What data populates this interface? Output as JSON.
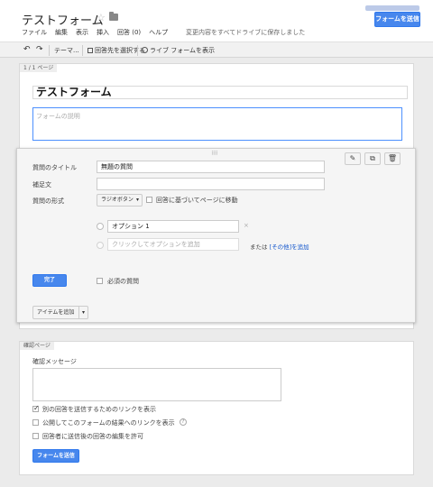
{
  "header": {
    "title": "テストフォーム",
    "menu": [
      "ファイル",
      "編集",
      "表示",
      "挿入",
      "回答 (0)",
      "ヘルプ"
    ],
    "save_status": "変更内容をすべてドライブに保存しました",
    "send_button": "フォームを送信"
  },
  "toolbar": {
    "theme": "テーマ...",
    "choose_dest": "回答先を選択する",
    "live_form": "ライブ フォームを表示"
  },
  "page1": {
    "label": "1 / 1 ページ",
    "form_title": "テストフォーム",
    "description_placeholder": "フォームの説明"
  },
  "question": {
    "title_label": "質問のタイトル",
    "title_value": "無題の質問",
    "help_label": "補足文",
    "help_value": "",
    "type_label": "質問の形式",
    "type_value": "ラジオボタン",
    "goto_page_label": "回答に基づいてページに移動",
    "option1": "オプション 1",
    "remove_icon": "×",
    "add_option_placeholder": "クリックしてオプションを追加",
    "or_text": "または",
    "other_link": "[その他]",
    "add_text": "を追加",
    "done_button": "完了",
    "required_label": "必須の質問"
  },
  "add_item": {
    "label": "アイテムを追加"
  },
  "confirmation": {
    "label": "確認ページ",
    "message_label": "確認メッセージ",
    "options": [
      {
        "label": "別の回答を送信するためのリンクを表示",
        "checked": true
      },
      {
        "label": "公開してこのフォームの結果へのリンクを表示",
        "checked": false
      },
      {
        "label": "回答者に送信後の回答の編集を許可",
        "checked": false
      }
    ],
    "help_icon": "?",
    "send_button": "フォームを送信"
  },
  "icons": {
    "star": "star-icon",
    "folder": "folder-icon",
    "undo": "undo-icon",
    "redo": "redo-icon",
    "pencil": "pencil-icon",
    "duplicate": "duplicate-icon",
    "trash": "trash-icon",
    "drag": "drag-handle-icon"
  },
  "colors": {
    "accent": "#4787ed",
    "link": "#1155cc"
  }
}
